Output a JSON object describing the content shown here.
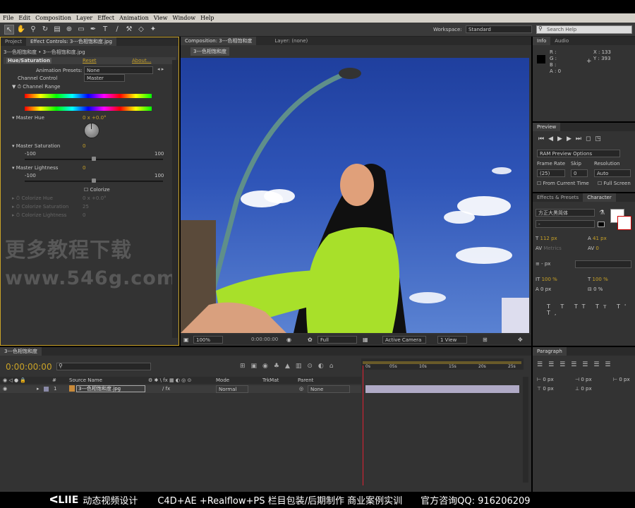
{
  "menu": [
    "File",
    "Edit",
    "Composition",
    "Layer",
    "Effect",
    "Animation",
    "View",
    "Window",
    "Help"
  ],
  "toolbar": {
    "workspace_label": "Workspace:",
    "workspace_value": "Standard",
    "search_placeholder": "Search Help"
  },
  "project_panel": {
    "tab_project": "Project",
    "tab_effect": "Effect Controls: 3---色相饱和度.jpg",
    "breadcrumb": "3---色相饱和度 • 3---色相饱和度.jpg",
    "effect_name": "Hue/Saturation",
    "reset": "Reset",
    "about": "About...",
    "anim_presets_label": "Animation Presets:",
    "anim_presets_value": "None",
    "channel_control_label": "Channel Control",
    "channel_control_value": "Master",
    "channel_range": "Channel Range",
    "master_hue_label": "Master Hue",
    "master_hue_value": "0 x +0.0°",
    "master_sat_label": "Master Saturation",
    "master_sat_value": "0",
    "master_sat_min": "-100",
    "master_sat_max": "100",
    "master_light_label": "Master Lightness",
    "master_light_value": "0",
    "master_light_min": "-100",
    "master_light_max": "100",
    "colorize": "Colorize",
    "colorize_hue": "Colorize Hue",
    "colorize_hue_value": "0 x +0.0°",
    "colorize_sat": "Colorize Saturation",
    "colorize_sat_value": "25",
    "colorize_light": "Colorize Lightness",
    "colorize_light_value": "0",
    "watermark1": "更多教程下载",
    "watermark2": "www.546g.com"
  },
  "comp_panel": {
    "tab_comp": "Composition: 3---色相饱和度",
    "tab_layer": "Layer: (none)",
    "sub_tab": "3---色相饱和度",
    "zoom": "100%",
    "timecode": "0:00:00:00",
    "resolution": "Full",
    "camera": "Active Camera",
    "view": "1 View"
  },
  "info_panel": {
    "tab_info": "Info",
    "tab_audio": "Audio",
    "r": "R :",
    "g": "G :",
    "b": "B :",
    "a": "A : 0",
    "x": "X : 133",
    "y": "Y : 393"
  },
  "preview_panel": {
    "title": "Preview",
    "ram": "RAM Preview Options",
    "frame_rate": "Frame Rate",
    "skip": "Skip",
    "resolution": "Resolution",
    "frame_rate_value": "(25)",
    "skip_value": "0",
    "resolution_value": "Auto",
    "from_current": "From Current Time",
    "full_screen": "Full Screen"
  },
  "character_panel": {
    "tab_effects": "Effects & Presets",
    "tab_character": "Character",
    "font": "方正大黑简体",
    "style": "-",
    "size": "112 px",
    "leading": "41 px",
    "kerning": "Metrics",
    "tracking": "0",
    "stroke": "- px",
    "vscale": "100 %",
    "hscale": "100 %",
    "baseline": "0 px",
    "tsume": "0 %"
  },
  "paragraph_panel": {
    "title": "Paragraph",
    "indent1": "0 px",
    "indent2": "0 px",
    "indent3": "0 px",
    "space1": "0 px",
    "space2": "0 px"
  },
  "timeline": {
    "tab": "3---色相饱和度",
    "timecode": "0:00:00:00",
    "col_source": "Source Name",
    "col_mode": "Mode",
    "col_trkmat": "TrkMat",
    "col_parent": "Parent",
    "layer_num": "1",
    "layer_name": "3---色相饱和度.jpg",
    "layer_mode": "Normal",
    "layer_parent": "None",
    "ruler": [
      "0s",
      "05s",
      "10s",
      "15s",
      "20s",
      "25s"
    ]
  },
  "footer": {
    "brand": "动态视频设计",
    "courses": "C4D+AE +Realflow+PS  栏目包装/后期制作 商业案例实训",
    "qq": "官方咨询QQ: 916206209"
  },
  "colors": {
    "accent": "#c9a227",
    "panel": "#333333",
    "sky": "#2f55b8"
  }
}
